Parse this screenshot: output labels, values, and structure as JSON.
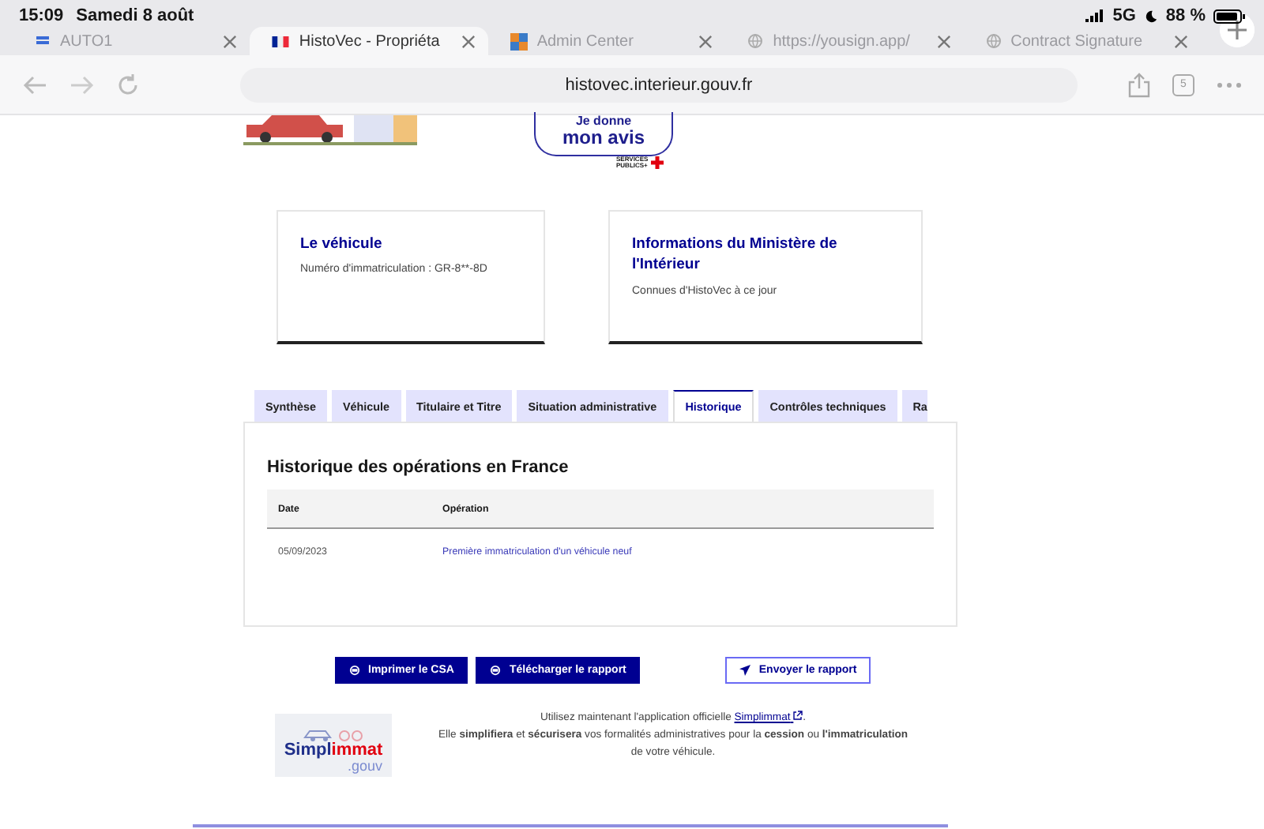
{
  "status_bar": {
    "time": "15:09",
    "date": "Samedi 8 août",
    "network": "5G",
    "battery": "88 %"
  },
  "browser_tabs": [
    {
      "title": "AUTO1",
      "selected": false,
      "kind": "app"
    },
    {
      "title": "HistoVec - Propriéta",
      "selected": true,
      "kind": "flag"
    },
    {
      "title": "Admin Center",
      "selected": false,
      "kind": "squares"
    },
    {
      "title": "https://yousign.app/",
      "selected": false,
      "kind": "globe"
    },
    {
      "title": "Contract Signature",
      "selected": false,
      "kind": "globe"
    }
  ],
  "address_bar": {
    "url": "histovec.interieur.gouv.fr",
    "tab_count": "5"
  },
  "feedback_badge": {
    "line_1": "Je donne",
    "line_2": "mon avis",
    "brand_1": "SERVICES",
    "brand_2": "PUBLICS+"
  },
  "cards": [
    {
      "title": "Le véhicule",
      "text": "Numéro d'immatriculation : GR-8**-8D"
    },
    {
      "title": "Informations du Ministère de l'Intérieur",
      "text": "Connues d'HistoVec à ce jour"
    }
  ],
  "tabs": [
    {
      "label": "Synthèse",
      "selected": false
    },
    {
      "label": "Véhicule",
      "selected": false
    },
    {
      "label": "Titulaire et Titre",
      "selected": false
    },
    {
      "label": "Situation administrative",
      "selected": false
    },
    {
      "label": "Historique",
      "selected": true
    },
    {
      "label": "Contrôles techniques",
      "selected": false
    },
    {
      "label": "Ra",
      "selected": false
    }
  ],
  "panel": {
    "title": "Historique des opérations en France",
    "table": {
      "columns": [
        "Date",
        "Opération"
      ],
      "rows": [
        [
          "05/09/2023",
          "Première immatriculation d'un véhicule neuf"
        ]
      ]
    }
  },
  "buttons": [
    {
      "label": "Imprimer le CSA",
      "kind": "primary"
    },
    {
      "label": "Télécharger le rapport",
      "kind": "primary"
    },
    {
      "label": "Envoyer le rapport",
      "kind": "secondary"
    }
  ],
  "footer": {
    "logo": {
      "part_1": "Simpl",
      "part_2": "immat",
      "suffix": ".gouv"
    },
    "line_1": "Utilisez maintenant l'application officielle",
    "link": "Simplimmat",
    "line_1_end": ".",
    "line_2": "Elle **simplifiera** et **sécurisera** vos formalités administratives pour la **cession** ou **l'immatriculation** de votre véhicule."
  }
}
